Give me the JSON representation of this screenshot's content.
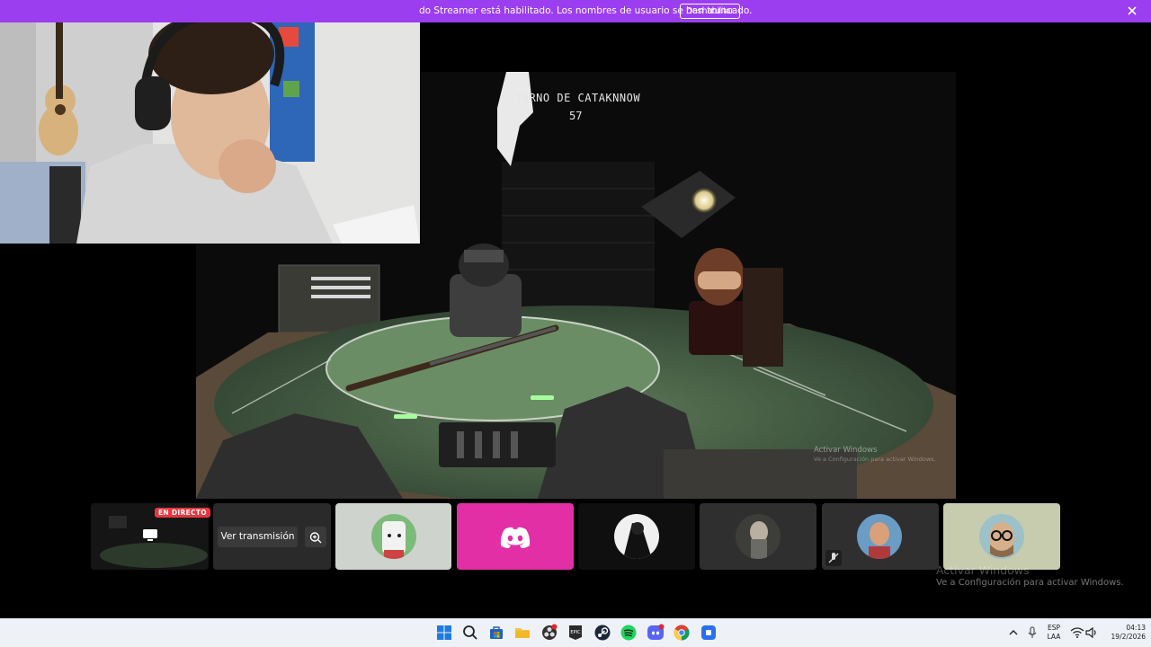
{
  "banner": {
    "text": "do Streamer está habilitado. Los nombres de usuario se han truncado.",
    "disable_label": "Deshabilitar",
    "color": "#9b3ef0"
  },
  "stream": {
    "turn_label": "TURNO DE CATAKNNOW",
    "turn_counter": "57",
    "windows_watermark_title": "Activar Windows",
    "windows_watermark_sub": "Ve a Configuración para activar Windows."
  },
  "participants": {
    "live_badge": "EN DIRECTO",
    "watch_button": "Ver transmisión",
    "tiles": [
      {
        "kind": "stream-preview"
      },
      {
        "kind": "watch"
      },
      {
        "kind": "avatar",
        "icon": "white-dog-avatar"
      },
      {
        "kind": "discord-logo",
        "color": "#e32fa5"
      },
      {
        "kind": "avatar",
        "icon": "dark-character-avatar"
      },
      {
        "kind": "avatar",
        "icon": "anime-girl-avatar"
      },
      {
        "kind": "avatar",
        "icon": "person-avatar",
        "muted": true
      },
      {
        "kind": "avatar",
        "icon": "glasses-man-avatar"
      }
    ]
  },
  "windows_watermark": {
    "title": "Activar Windows",
    "subtitle": "Ve a Configuración para activar Windows."
  },
  "taskbar": {
    "apps": [
      "windows-start-icon",
      "search-icon",
      "microsoft-store-icon",
      "file-explorer-icon",
      "obs-icon",
      "epic-games-icon",
      "steam-icon",
      "spotify-icon",
      "discord-icon",
      "chrome-icon",
      "app-icon"
    ],
    "language_top": "ESP",
    "language_bottom": "LAA",
    "time": "04:13",
    "date": "19/2/2026"
  }
}
